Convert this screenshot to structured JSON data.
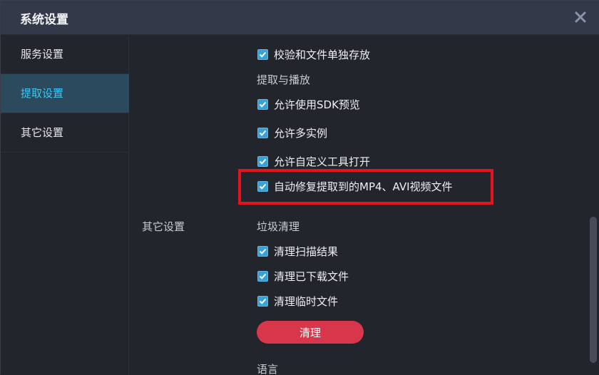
{
  "window": {
    "title": "系统设置",
    "close_icon": "close-icon"
  },
  "sidebar": {
    "items": [
      {
        "label": "服务设置",
        "active": false
      },
      {
        "label": "提取设置",
        "active": true
      },
      {
        "label": "其它设置",
        "active": false
      }
    ]
  },
  "content": {
    "top_option": {
      "label": "校验和文件单独存放",
      "checked": true
    },
    "extract_section": {
      "title": "提取与播放",
      "options": [
        {
          "label": "允许使用SDK预览",
          "checked": true
        },
        {
          "label": "允许多实例",
          "checked": true
        },
        {
          "label": "允许自定义工具打开",
          "checked": true
        },
        {
          "label": "自动修复提取到的MP4、AVI视频文件",
          "checked": true
        }
      ]
    },
    "other_group_label": "其它设置",
    "trash_section": {
      "title": "垃圾清理",
      "options": [
        {
          "label": "清理扫描结果",
          "checked": true
        },
        {
          "label": "清理已下载文件",
          "checked": true
        },
        {
          "label": "清理临时文件",
          "checked": true
        }
      ],
      "button_label": "清理"
    },
    "language_section": {
      "title": "语言"
    }
  },
  "colors": {
    "accent": "#3ec6f2",
    "checkbox": "#3aa1d8",
    "highlight": "#e5141c",
    "clean_button": "#d8364a",
    "active_sidebar_bg": "#2b4a5d"
  }
}
